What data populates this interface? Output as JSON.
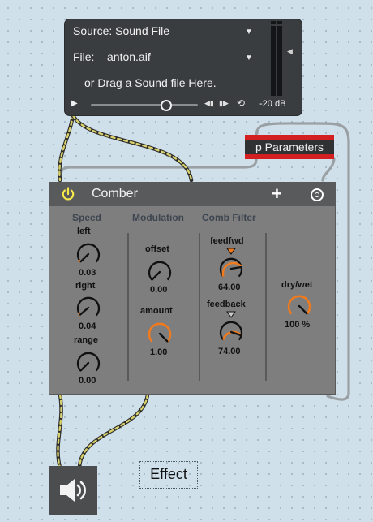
{
  "player": {
    "source_label": "Source: Sound File",
    "file_label": "File:",
    "file_name": "anton.aif",
    "drag_hint": "or Drag a Sound file Here.",
    "level": "-20 dB"
  },
  "subpatch": {
    "label": "p Parameters"
  },
  "device": {
    "title": "Comber",
    "sections": {
      "speed": "Speed",
      "modulation": "Modulation",
      "comb_filter": "Comb Filter"
    },
    "dials": {
      "left": {
        "label": "left",
        "value": "0.03"
      },
      "right": {
        "label": "right",
        "value": "0.04"
      },
      "range": {
        "label": "range",
        "value": "0.00"
      },
      "offset": {
        "label": "offset",
        "value": "0.00"
      },
      "amount": {
        "label": "amount",
        "value": "1.00"
      },
      "feedfwd": {
        "label": "feedfwd",
        "value": "64.00"
      },
      "feedback": {
        "label": "feedback",
        "value": "74.00"
      },
      "drywet": {
        "label": "dry/wet",
        "value": "100 %"
      }
    },
    "colors": {
      "accent": "#f07a1e",
      "power": "#f5e94a"
    }
  },
  "comment": {
    "text": "Effect"
  },
  "icons": {
    "speaker": "speaker-icon",
    "power": "power-icon",
    "plus": "plus-icon",
    "menu": "ring-icon"
  }
}
